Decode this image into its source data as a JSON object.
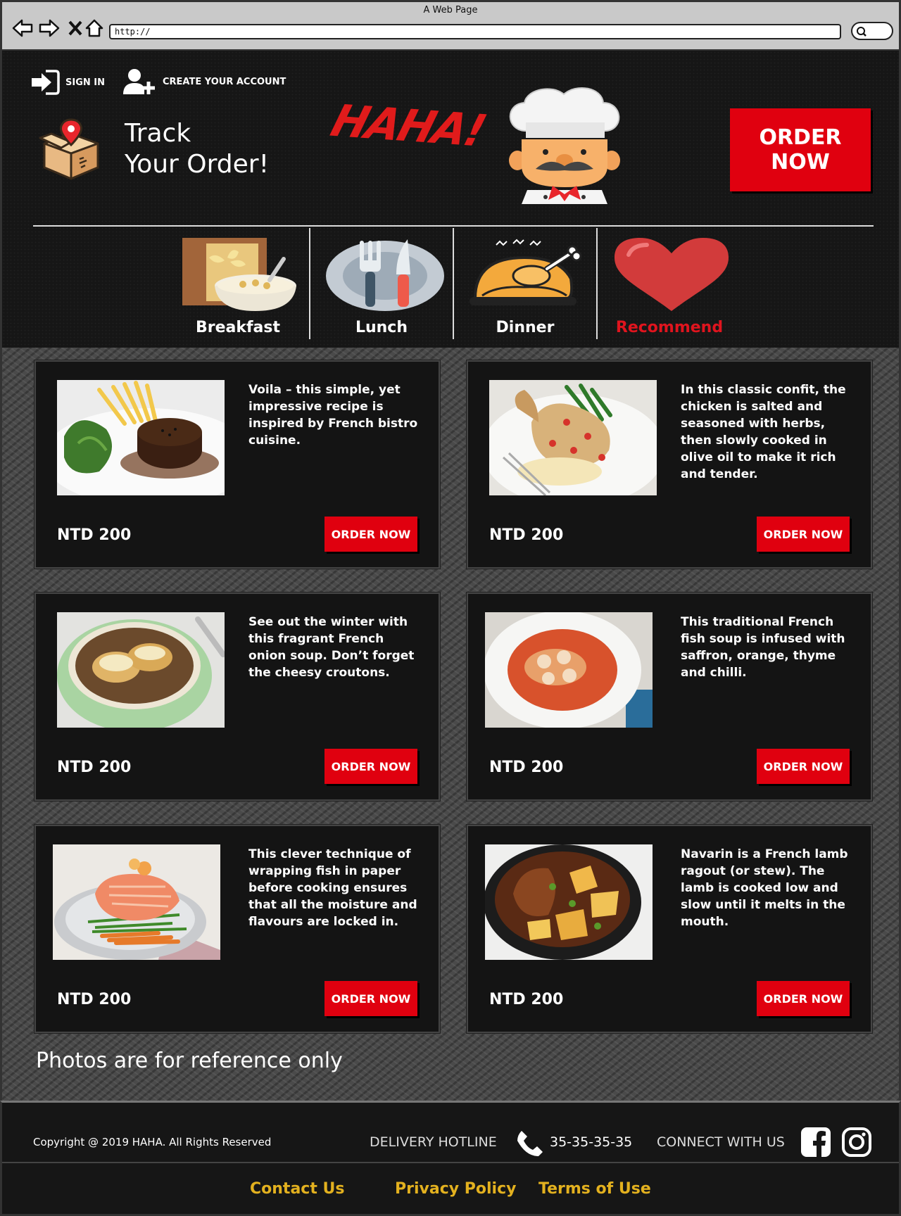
{
  "browser": {
    "title": "A Web Page",
    "url": "http://"
  },
  "header": {
    "sign_in": "SIGN IN",
    "create_account": "CREATE YOUR ACCOUNT",
    "track_line1": "Track",
    "track_line2": "Your Order!",
    "logo": "HAHA!",
    "order_now": "ORDER NOW"
  },
  "categories": [
    {
      "label": "Breakfast",
      "icon": "cereal-bowl-icon"
    },
    {
      "label": "Lunch",
      "icon": "plate-fork-knife-icon"
    },
    {
      "label": "Dinner",
      "icon": "roast-chicken-icon"
    },
    {
      "label": "Recommend",
      "icon": "heart-icon"
    }
  ],
  "cards": [
    {
      "description": "Voila – this simple, yet impressive recipe is inspired by French bistro cuisine.",
      "price": "NTD 200",
      "button": "ORDER NOW",
      "photo": "steak-with-fries-photo"
    },
    {
      "description": "In this classic confit, the chicken is salted and seasoned with herbs, then slowly cooked in olive oil to make it rich and tender.",
      "price": "NTD 200",
      "button": "ORDER NOW",
      "photo": "chicken-confit-photo"
    },
    {
      "description": "See out the winter with this fragrant French onion soup. Don’t forget the cheesy croutons.",
      "price": "NTD 200",
      "button": "ORDER NOW",
      "photo": "onion-soup-photo"
    },
    {
      "description": "This traditional French fish soup is infused with saffron, orange, thyme and chilli.",
      "price": "NTD 200",
      "button": "ORDER NOW",
      "photo": "fish-soup-photo"
    },
    {
      "description": "This clever technique of wrapping fish in paper before cooking ensures that all the moisture and flavours are locked in.",
      "price": "NTD 200",
      "button": "ORDER NOW",
      "photo": "salmon-photo"
    },
    {
      "description": "Navarin is a French lamb ragout (or stew). The lamb is cooked low and slow until it melts in the mouth.",
      "price": "NTD 200",
      "button": "ORDER NOW",
      "photo": "lamb-stew-photo"
    }
  ],
  "notice": "Photos are for reference only",
  "footer": {
    "copyright": "Copyright @ 2019 HAHA. All Rights Reserved",
    "hotline_label": "DELIVERY HOTLINE",
    "hotline_number": "35-35-35-35",
    "connect_label": "CONNECT WITH US",
    "links": [
      "Contact Us",
      "Privacy Policy",
      "Terms of Use"
    ]
  },
  "colors": {
    "accent_red": "#e0000f",
    "link_gold": "#e3b11f",
    "background_dark": "#161616"
  }
}
